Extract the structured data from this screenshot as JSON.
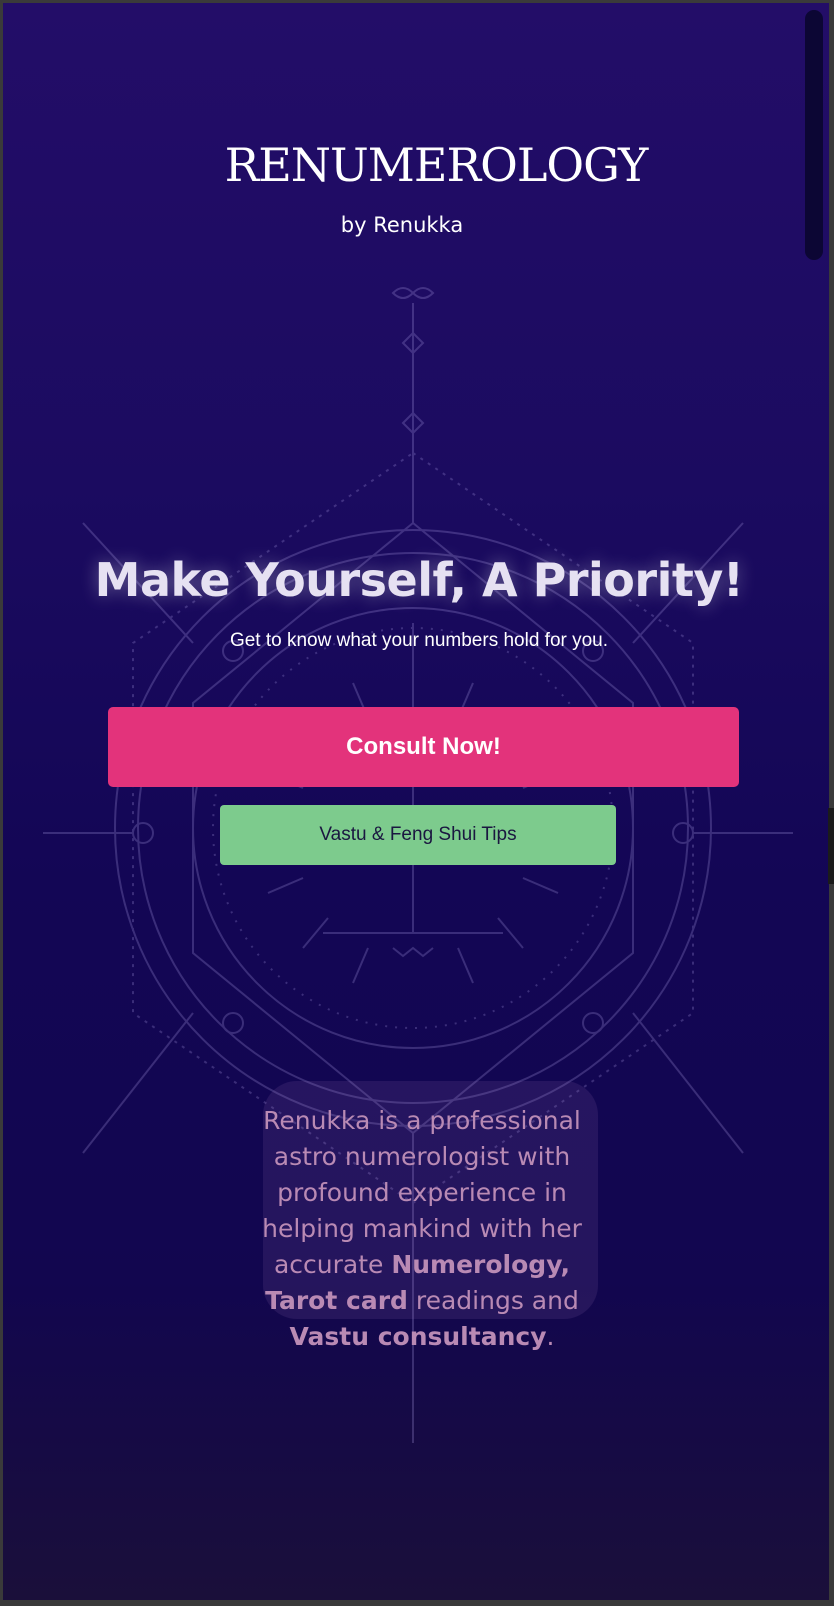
{
  "brand": {
    "title": "RENUMEROLOGY",
    "subtitle": "by Renukka"
  },
  "hero": {
    "heading": "Make Yourself, A Priority!",
    "subheading": "Get to know what your numbers hold for you."
  },
  "buttons": {
    "consult_label": "Consult Now!",
    "vastu_label": "Vastu & Feng Shui Tips"
  },
  "about": {
    "intro": "Renukka is a professional astro numerologist with profound experience in helping mankind with her accurate ",
    "highlight_1": "Numerology, Tarot card",
    "middle": " readings and ",
    "highlight_2": "Vastu consultancy",
    "end": "."
  },
  "colors": {
    "background_top": "#230d68",
    "background_bottom": "#12064f",
    "consult_button": "#e3337b",
    "vastu_button": "#7dcb8d",
    "about_text": "#b98ab4"
  }
}
